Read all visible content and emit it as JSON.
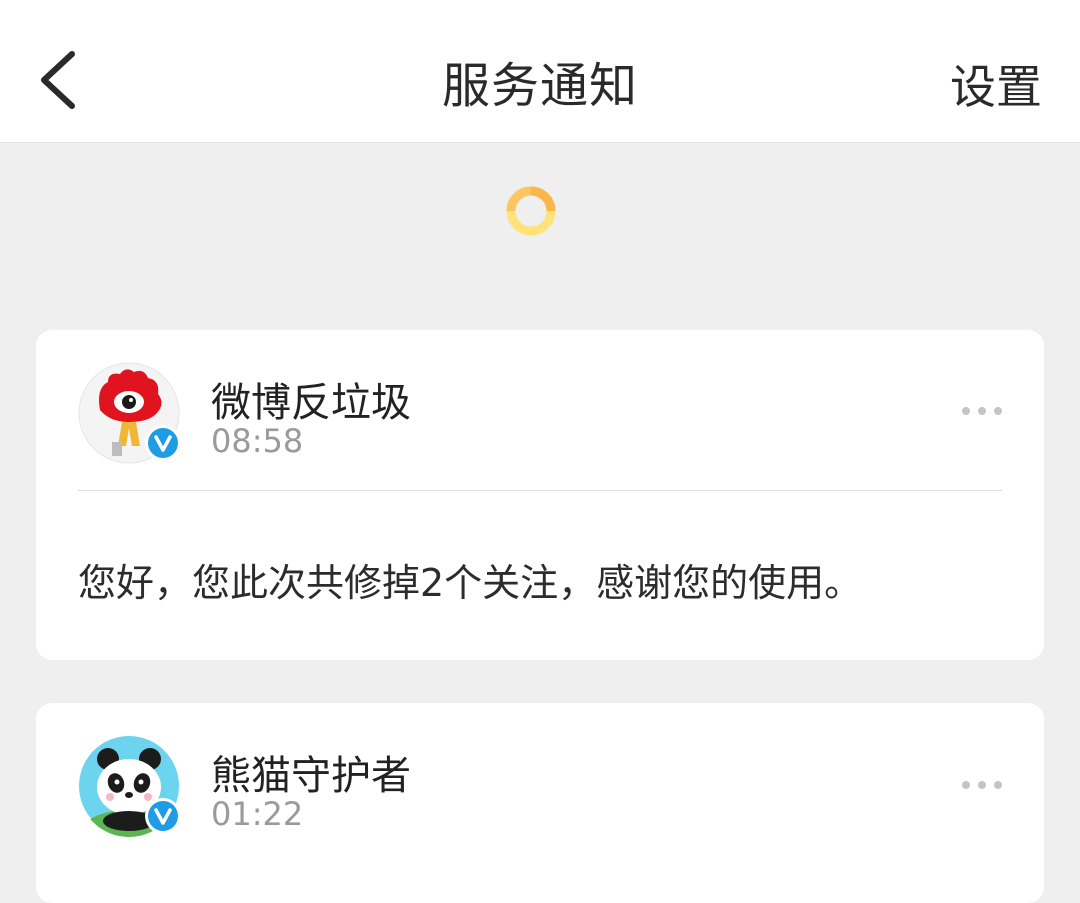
{
  "header": {
    "title": "服务通知",
    "settings_label": "设置"
  },
  "notifications": [
    {
      "sender": "微博反垃圾",
      "time": "08:58",
      "verified": true,
      "avatar_icon": "weibo-eye-logo",
      "message": "您好，您此次共修掉2个关注，感谢您的使用。"
    },
    {
      "sender": "熊猫守护者",
      "time": "01:22",
      "verified": true,
      "avatar_icon": "panda-logo"
    }
  ],
  "colors": {
    "verified_badge": "#1e9ce6",
    "spinner_orange": "#f9b74b",
    "spinner_yellow": "#ffe27a"
  }
}
